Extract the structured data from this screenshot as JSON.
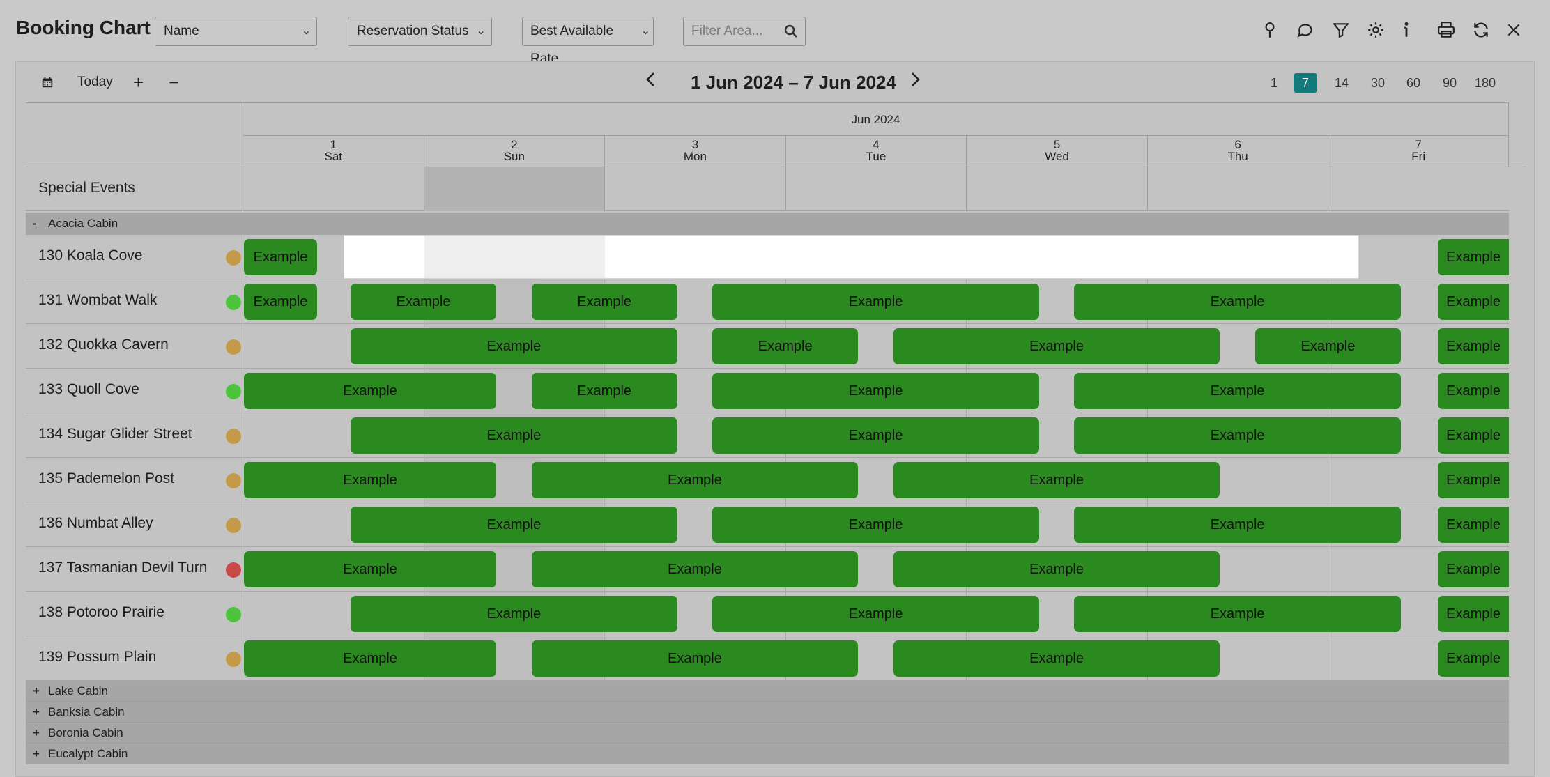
{
  "app": {
    "title": "Booking Chart"
  },
  "toolbar": {
    "name_select": "Name",
    "status_select": "Reservation Status",
    "rate_select": "Best Available Rate",
    "filter_placeholder": "Filter Area...",
    "icons": [
      "location-pin-icon",
      "chat-bubble-icon",
      "filter-icon",
      "gear-icon",
      "info-icon",
      "printer-icon",
      "refresh-icon",
      "close-icon"
    ]
  },
  "nav": {
    "today": "Today",
    "plus": "+",
    "minus": "−",
    "prev": "‹",
    "next": "›",
    "date_range": "1 Jun 2024 – 7 Jun 2024",
    "zoom_options": [
      "1",
      "7",
      "14",
      "30",
      "60",
      "90",
      "180"
    ],
    "zoom_active": "7"
  },
  "calendar": {
    "month": "Jun 2024",
    "days": [
      {
        "num": "1",
        "dow": "Sat"
      },
      {
        "num": "2",
        "dow": "Sun"
      },
      {
        "num": "3",
        "dow": "Mon"
      },
      {
        "num": "4",
        "dow": "Tue"
      },
      {
        "num": "5",
        "dow": "Wed"
      },
      {
        "num": "6",
        "dow": "Thu"
      },
      {
        "num": "7",
        "dow": "Fri"
      }
    ]
  },
  "special_events": {
    "label": "Special Events"
  },
  "groups": {
    "expanded": {
      "toggle": "-",
      "name": "Acacia Cabin"
    },
    "collapsed": [
      {
        "toggle": "+",
        "name": "Lake Cabin"
      },
      {
        "toggle": "+",
        "name": "Banksia Cabin"
      },
      {
        "toggle": "+",
        "name": "Boronia Cabin"
      },
      {
        "toggle": "+",
        "name": "Eucalypt Cabin"
      }
    ]
  },
  "colors": {
    "booking": "#2b8a1f",
    "status_orange": "#c49a4a",
    "status_green": "#4cc43c",
    "status_red": "#c94848",
    "accent_active": "#137a7a"
  },
  "booking_label": "Example",
  "rooms": [
    {
      "name": "130 Koala Cove",
      "status": "orange",
      "bookings": [
        {
          "start": 0,
          "end": 0.42
        },
        {
          "start": 6.6,
          "end": 7.0,
          "cut": true
        }
      ],
      "blank": {
        "start": 0.56,
        "end": 6.17
      }
    },
    {
      "name": "131 Wombat Walk",
      "status": "green",
      "bookings": [
        {
          "start": 0,
          "end": 0.42
        },
        {
          "start": 0.59,
          "end": 1.41
        },
        {
          "start": 1.59,
          "end": 2.41
        },
        {
          "start": 2.59,
          "end": 4.41
        },
        {
          "start": 4.59,
          "end": 6.41
        },
        {
          "start": 6.6,
          "end": 7.0,
          "cut": true
        }
      ]
    },
    {
      "name": "132 Quokka Cavern",
      "status": "orange",
      "bookings": [
        {
          "start": 0.59,
          "end": 2.41
        },
        {
          "start": 2.59,
          "end": 3.41
        },
        {
          "start": 3.59,
          "end": 5.41
        },
        {
          "start": 5.59,
          "end": 6.41
        },
        {
          "start": 6.6,
          "end": 7.0,
          "cut": true
        }
      ]
    },
    {
      "name": "133 Quoll Cove",
      "status": "green",
      "bookings": [
        {
          "start": 0,
          "end": 1.41
        },
        {
          "start": 1.59,
          "end": 2.41
        },
        {
          "start": 2.59,
          "end": 4.41
        },
        {
          "start": 4.59,
          "end": 6.41
        },
        {
          "start": 6.6,
          "end": 7.0,
          "cut": true
        }
      ]
    },
    {
      "name": "134 Sugar Glider Street",
      "status": "orange",
      "bookings": [
        {
          "start": 0.59,
          "end": 2.41
        },
        {
          "start": 2.59,
          "end": 4.41
        },
        {
          "start": 4.59,
          "end": 6.41
        },
        {
          "start": 6.6,
          "end": 7.0,
          "cut": true
        }
      ]
    },
    {
      "name": "135 Pademelon Post",
      "status": "orange",
      "bookings": [
        {
          "start": 0,
          "end": 1.41
        },
        {
          "start": 1.59,
          "end": 3.41
        },
        {
          "start": 3.59,
          "end": 5.41
        },
        {
          "start": 6.6,
          "end": 7.0,
          "cut": true
        }
      ]
    },
    {
      "name": "136 Numbat Alley",
      "status": "orange",
      "bookings": [
        {
          "start": 0.59,
          "end": 2.41
        },
        {
          "start": 2.59,
          "end": 4.41
        },
        {
          "start": 4.59,
          "end": 6.41
        },
        {
          "start": 6.6,
          "end": 7.0,
          "cut": true
        }
      ]
    },
    {
      "name": "137 Tasmanian Devil Turn",
      "status": "red",
      "bookings": [
        {
          "start": 0,
          "end": 1.41
        },
        {
          "start": 1.59,
          "end": 3.41
        },
        {
          "start": 3.59,
          "end": 5.41
        },
        {
          "start": 6.6,
          "end": 7.0,
          "cut": true
        }
      ]
    },
    {
      "name": "138 Potoroo Prairie",
      "status": "green",
      "bookings": [
        {
          "start": 0.59,
          "end": 2.41
        },
        {
          "start": 2.59,
          "end": 4.41
        },
        {
          "start": 4.59,
          "end": 6.41
        },
        {
          "start": 6.6,
          "end": 7.0,
          "cut": true
        }
      ]
    },
    {
      "name": "139 Possum Plain",
      "status": "orange",
      "bookings": [
        {
          "start": 0,
          "end": 1.41
        },
        {
          "start": 1.59,
          "end": 3.41
        },
        {
          "start": 3.59,
          "end": 5.41
        },
        {
          "start": 6.6,
          "end": 7.0,
          "cut": true
        }
      ]
    }
  ]
}
